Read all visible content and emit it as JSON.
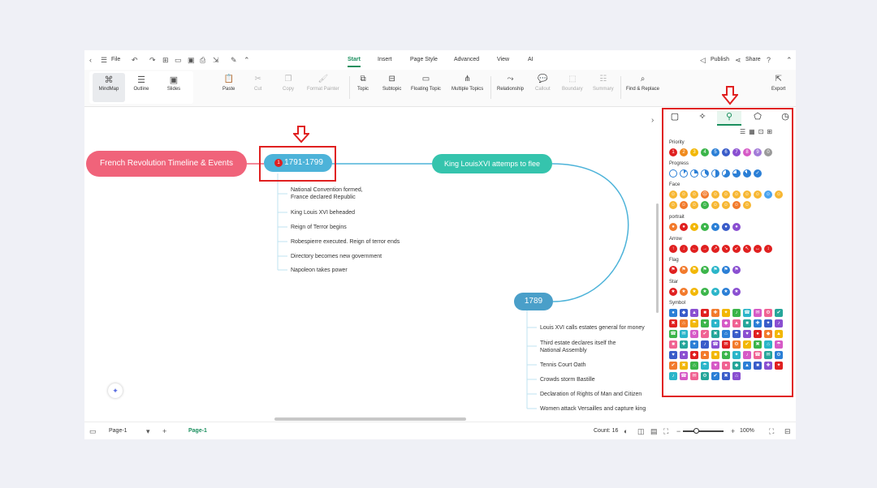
{
  "menubar": {
    "file_label": "File",
    "tabs": [
      "Start",
      "Insert",
      "Page Style",
      "Advanced",
      "View",
      "AI"
    ],
    "active_tab": "Start",
    "publish_label": "Publish",
    "share_label": "Share"
  },
  "ribbon": {
    "views": [
      "MindMap",
      "Outline",
      "Slides"
    ],
    "buttons": [
      "Paste",
      "Cut",
      "Copy",
      "Format Painter",
      "Topic",
      "Subtopic",
      "Floating Topic",
      "Multiple Topics",
      "Relationship",
      "Callout",
      "Boundary",
      "Summary",
      "Find & Replace",
      "Export"
    ]
  },
  "mindmap": {
    "central": "French Revolution Timeline & Events",
    "topic_a": "1791-1799",
    "topic_a_marker": "1",
    "topic_a_subs": [
      "National Convention formed,",
      "France declared Republic",
      "King Louis XVI beheaded",
      "Reign of Terror begins",
      "Robespierre executed. Reign of terror ends",
      "Directory becomes new government",
      "Napoleon takes power"
    ],
    "topic_b": "King LouisXVI attemps to flee",
    "topic_c": "1789",
    "topic_c_subs": [
      "Louis XVI calls estates general for money",
      "Third estate declares itself the",
      "National Assembly",
      "Tennis Court Oath",
      "Crowds storm Bastille",
      "Declaration of Rights of Man and Citizen",
      "Women attack Versailles and capture king"
    ]
  },
  "panel": {
    "sections": [
      "Priority",
      "Progress",
      "Face",
      "portrait",
      "Arrow",
      "Flag",
      "Star",
      "Symbol"
    ],
    "priority_numbers": [
      "1",
      "2",
      "3",
      "4",
      "5",
      "6",
      "7",
      "8",
      "9",
      "0"
    ],
    "colors": {
      "accent": "#1a8f5e",
      "central": "#f0637a",
      "topic": "#4db3d9",
      "topic_b": "#35c4ad",
      "topic_c": "#4a9fc9",
      "highlight": "#e02020",
      "blue": "#2b7fd6"
    }
  },
  "statusbar": {
    "page_select": "Page-1",
    "page_tab": "Page-1",
    "count": "Count: 16",
    "zoom": "100%"
  }
}
